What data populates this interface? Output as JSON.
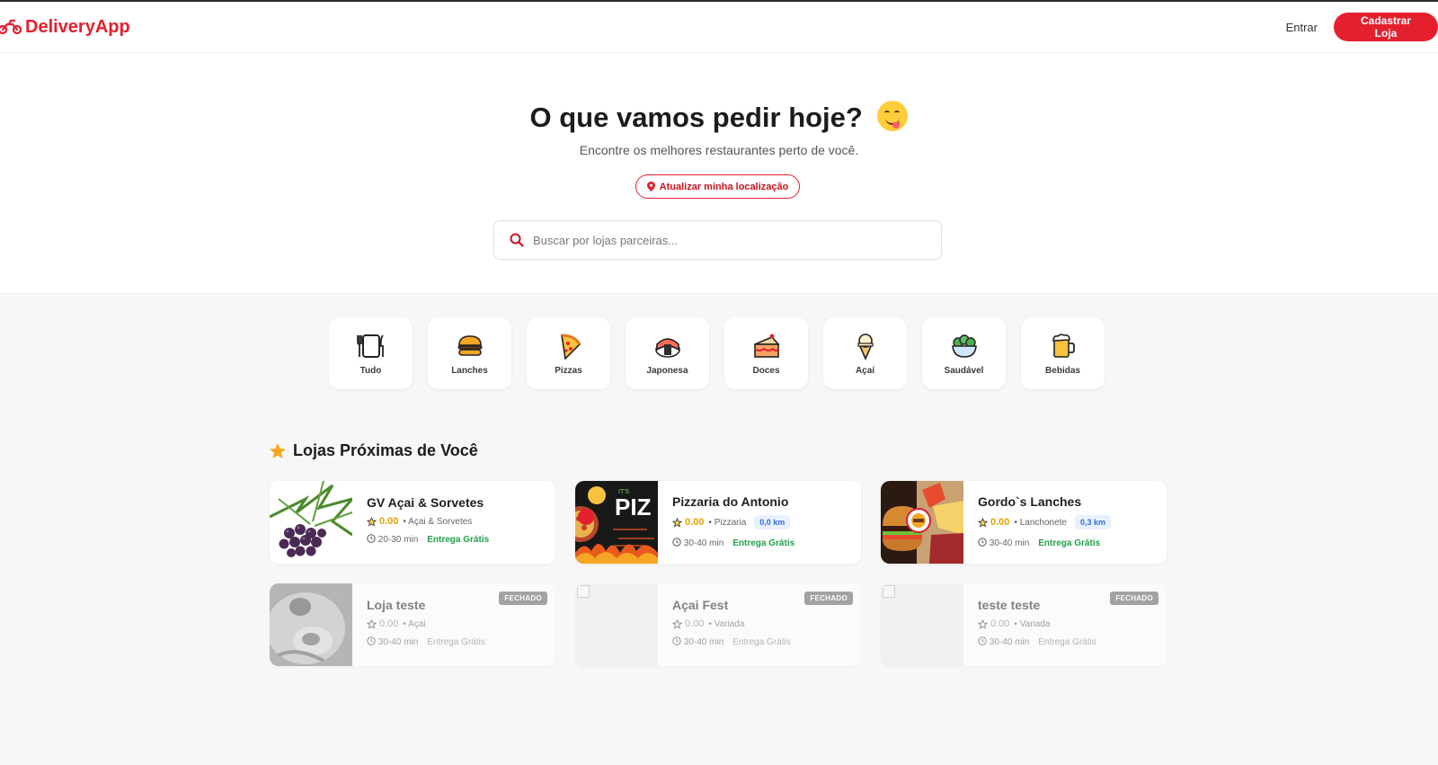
{
  "nav": {
    "brand": "DeliveryApp",
    "login_label": "Entrar",
    "register_label": "Cadastrar Loja",
    "brand_color": "#e4202f"
  },
  "hero": {
    "title": "O que vamos pedir hoje?",
    "subtitle": "Encontre os melhores restaurantes perto de você.",
    "location_label": "Atualizar minha localização",
    "search_placeholder": "Buscar por lojas parceiras..."
  },
  "categories": [
    {
      "label": "Tudo",
      "icon": "utensils-icon"
    },
    {
      "label": "Lanches",
      "icon": "burger-icon"
    },
    {
      "label": "Pizzas",
      "icon": "pizza-icon"
    },
    {
      "label": "Japonesa",
      "icon": "sushi-icon"
    },
    {
      "label": "Doces",
      "icon": "cake-icon"
    },
    {
      "label": "Açaí",
      "icon": "ice-cream-icon"
    },
    {
      "label": "Saudável",
      "icon": "salad-icon"
    },
    {
      "label": "Bebidas",
      "icon": "beer-icon"
    }
  ],
  "section": {
    "title": "Lojas Próximas de Você"
  },
  "stores": [
    {
      "name": "GV Açai & Sorvetes",
      "rating": "0.00",
      "category": "• Açai & Sorvetes",
      "distance": "",
      "time": "20-30 min",
      "delivery": "Entrega Grátis",
      "closed": false
    },
    {
      "name": "Pizzaria do Antonio",
      "rating": "0.00",
      "category": "• Pizzaria",
      "distance": "0,0 km",
      "time": "30-40 min",
      "delivery": "Entrega Grátis",
      "closed": false
    },
    {
      "name": "Gordo`s Lanches",
      "rating": "0.00",
      "category": "• Lanchonete",
      "distance": "0,3 km",
      "time": "30-40 min",
      "delivery": "Entrega Grátis",
      "closed": false
    },
    {
      "name": "Loja teste",
      "rating": "0.00",
      "category": "• Açai",
      "distance": "",
      "time": "30-40 min",
      "delivery": "Entrega Grátis",
      "closed": true,
      "badge": "FECHADO"
    },
    {
      "name": "Açai Fest",
      "rating": "0.00",
      "category": "• Variada",
      "distance": "",
      "time": "30-40 min",
      "delivery": "Entrega Grátis",
      "closed": true,
      "badge": "FECHADO"
    },
    {
      "name": "teste teste",
      "rating": "0.00",
      "category": "• Variada",
      "distance": "",
      "time": "30-40 min",
      "delivery": "Entrega Grátis",
      "closed": true,
      "badge": "FECHADO"
    }
  ]
}
